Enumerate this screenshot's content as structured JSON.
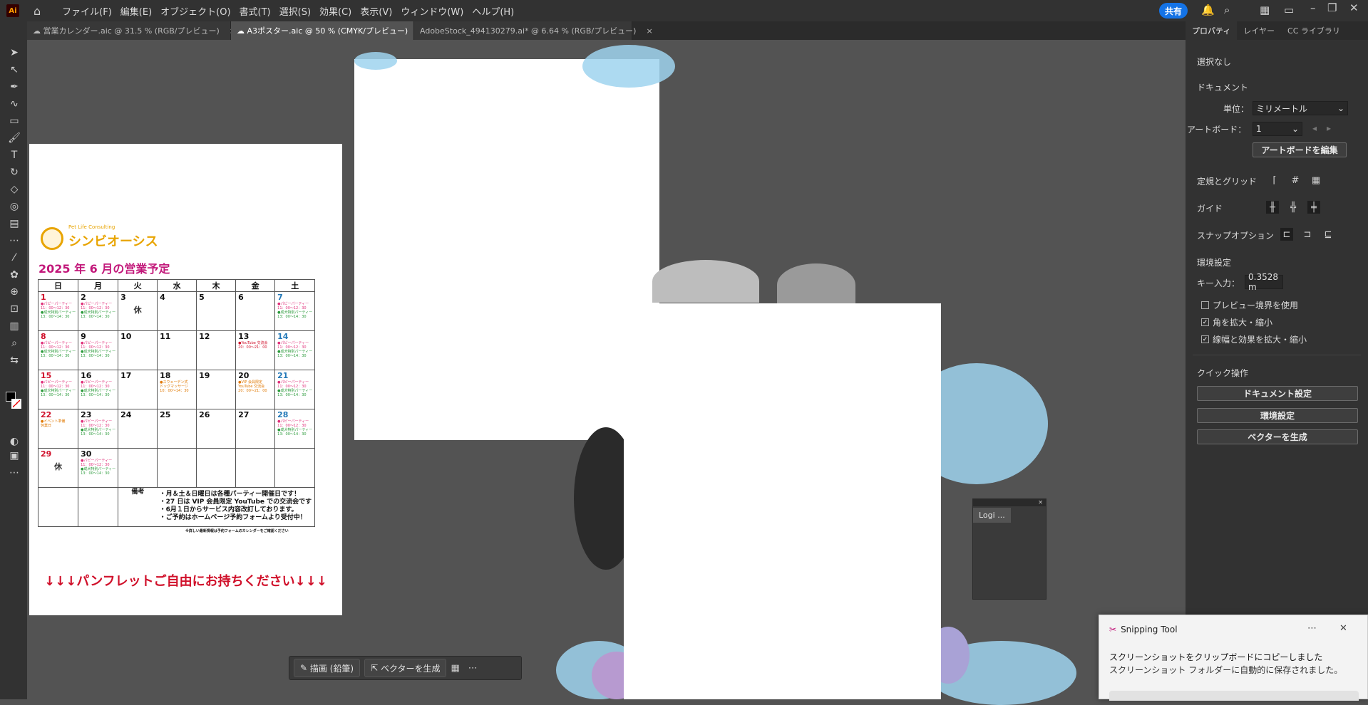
{
  "menubar": {
    "app_logo": "Ai",
    "items": [
      "ファイル(F)",
      "編集(E)",
      "オブジェクト(O)",
      "書式(T)",
      "選択(S)",
      "効果(C)",
      "表示(V)",
      "ウィンドウ(W)",
      "ヘルプ(H)"
    ],
    "share": "共有"
  },
  "tabs": [
    {
      "label": "営業カレンダー.aic @ 31.5 % (RGB/プレビュー)",
      "close": "×"
    },
    {
      "label": "A3ポスター.aic @ 50 % (CMYK/プレビュー)",
      "close": "×"
    },
    {
      "label": "AdobeStock_494130279.ai* @ 6.64 % (RGB/プレビュー)",
      "close": "×"
    }
  ],
  "panel": {
    "tabs": [
      "プロパティ",
      "レイヤー",
      "CC ライブラリ"
    ],
    "no_selection": "選択なし",
    "document": "ドキュメント",
    "unit_label": "単位：",
    "unit_value": "ミリメートル",
    "artboard_label": "アートボード：",
    "artboard_value": "1",
    "edit_artboard": "アートボードを編集",
    "rulers_grids": "定規とグリッド",
    "guides": "ガイド",
    "snap_options": "スナップオプション",
    "preferences": "環境設定",
    "key_input_label": "キー入力：",
    "key_input_value": "0.3528 m",
    "chk_preview_bounds": "プレビュー境界を使用",
    "chk_scale_corners": "角を拡大・縮小",
    "chk_scale_strokes": "線幅と効果を拡大・縮小",
    "quick_actions": "クイック操作",
    "doc_setup": "ドキュメント設定",
    "pref_btn": "環境設定",
    "gen_vector": "ベクターを生成"
  },
  "calendar": {
    "logo_sub": "Pet Life Consulting",
    "logo": "シンビオーシス",
    "title": "2025 年 6 月の営業予定",
    "weekdays": [
      "日",
      "月",
      "火",
      "水",
      "木",
      "金",
      "土"
    ],
    "notes_label": "備考",
    "notes": [
      "・月＆土＆日曜日は各種パーティー開催日です！",
      "・27 日は VIP 会員限定 YouTube での交流会です",
      "・6月１日からサービス内容改訂しております。",
      "・ご予約はホームページ予約フォームより受付中！"
    ],
    "footnote": "※詳しい最新情報は予約フォームのカレンダーをご確認ください",
    "banner": "↓↓↓パンフレットご自由にお持ちください↓↓↓",
    "closed": "休"
  },
  "floatbar": {
    "draw": "描画 (鉛筆)",
    "generate": "ベクターを生成"
  },
  "mini_panel": {
    "tab": "Logi ..."
  },
  "snip": {
    "title": "Snipping Tool",
    "line1": "スクリーンショットをクリップボードにコピーしました",
    "line2": "スクリーンショット フォルダーに自動的に保存されました。"
  }
}
